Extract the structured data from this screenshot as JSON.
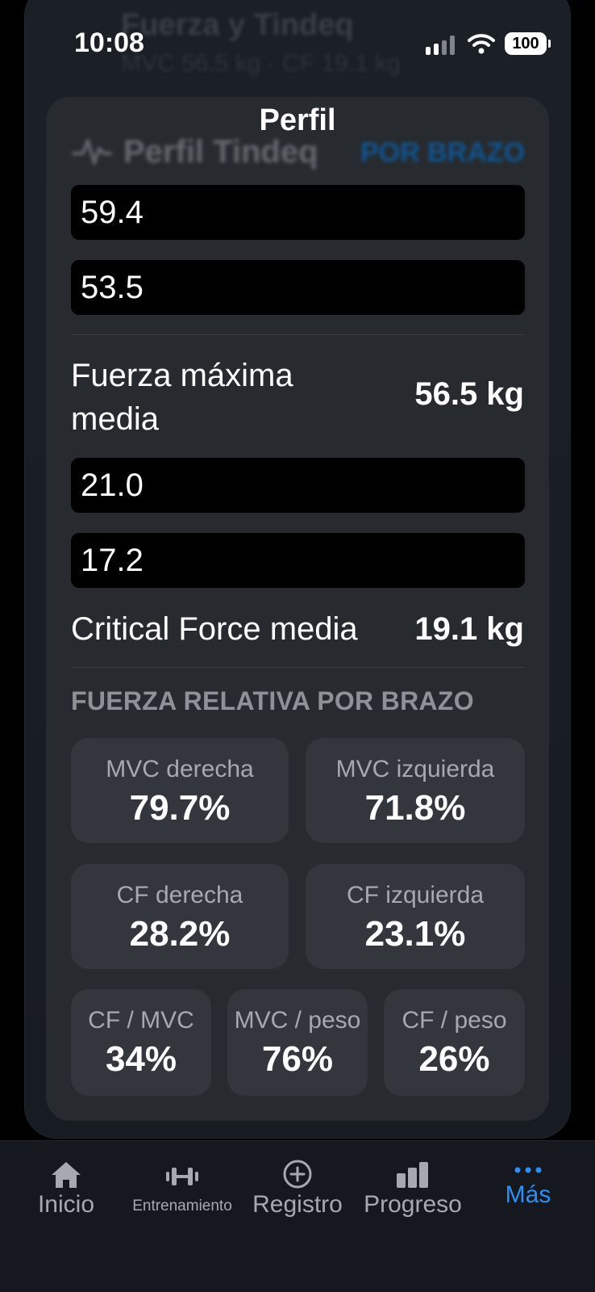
{
  "status_bar": {
    "time": "10:08",
    "battery": "100"
  },
  "background": {
    "title": "Fuerza y Tindeq",
    "subtitle": "MVC 56.5 kg · CF 19.1 kg"
  },
  "nav": {
    "title": "Perfil"
  },
  "card_header": {
    "title": "Perfil Tindeq",
    "action": "POR BRAZO"
  },
  "inputs": {
    "mvc_right": "59.4",
    "mvc_left": "53.5",
    "cf_right": "21.0",
    "cf_left": "17.2"
  },
  "summary": {
    "max_force_label": "Fuerza máxima media",
    "max_force_value": "56.5 kg",
    "critical_force_label": "Critical Force media",
    "critical_force_value": "19.1 kg"
  },
  "relative": {
    "header": "FUERZA RELATIVA POR BRAZO",
    "tiles": [
      {
        "label": "MVC derecha",
        "value": "79.7%"
      },
      {
        "label": "MVC izquierda",
        "value": "71.8%"
      },
      {
        "label": "CF derecha",
        "value": "28.2%"
      },
      {
        "label": "CF izquierda",
        "value": "23.1%"
      },
      {
        "label": "CF / MVC",
        "value": "34%"
      },
      {
        "label": "MVC / peso",
        "value": "76%"
      },
      {
        "label": "CF / peso",
        "value": "26%"
      }
    ]
  },
  "tabs": [
    {
      "label": "Inicio",
      "icon": "house-icon"
    },
    {
      "label": "Entrenamiento",
      "icon": "dumbbell-icon"
    },
    {
      "label": "Registro",
      "icon": "plus-circle-icon"
    },
    {
      "label": "Progreso",
      "icon": "chart-bar-icon"
    },
    {
      "label": "Más",
      "icon": "ellipsis-icon",
      "active": true
    }
  ],
  "colors": {
    "accent": "#2a8ff7",
    "card": "#272b30",
    "tile": "#33373d"
  }
}
